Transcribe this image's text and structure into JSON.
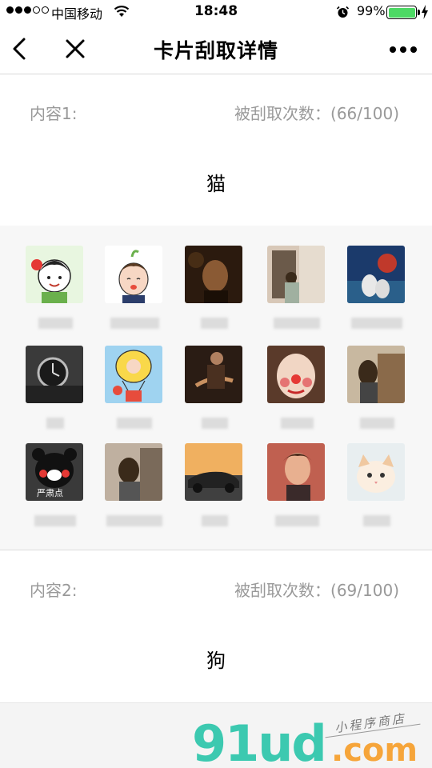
{
  "status_bar": {
    "carrier": "中国移动",
    "time": "18:48",
    "battery_pct": "99%",
    "icons": [
      "signal-dots-icon",
      "wifi-icon",
      "alarm-icon",
      "battery-icon",
      "charging-bolt-icon"
    ]
  },
  "nav": {
    "title": "卡片刮取详情",
    "icons": [
      "back-chevron-icon",
      "close-icon",
      "more-dots-icon"
    ]
  },
  "contents": [
    {
      "label": "内容1:",
      "count": "被刮取次数：(66/100)",
      "word": "猫"
    },
    {
      "label": "内容2:",
      "count": "被刮取次数：(69/100)",
      "word": "狗"
    }
  ],
  "scrapers": [
    {
      "avatar": "cartoon-girl-sticker",
      "name_width": 0.58
    },
    {
      "avatar": "cartoon-boy-sticker",
      "name_width": 0.82
    },
    {
      "avatar": "dark-portrait",
      "name_width": 0.46
    },
    {
      "avatar": "person-by-door",
      "name_width": 0.78
    },
    {
      "avatar": "couple-by-sea",
      "name_width": 0.86
    },
    {
      "avatar": "wristwatch",
      "name_width": 0.3
    },
    {
      "avatar": "cartoon-balloon",
      "name_width": 0.6
    },
    {
      "avatar": "guitar-player",
      "name_width": 0.45
    },
    {
      "avatar": "clown-face",
      "name_width": 0.56
    },
    {
      "avatar": "girl-by-fence",
      "name_width": 0.58
    },
    {
      "avatar": "black-bear-mascot",
      "name_width": 0.7
    },
    {
      "avatar": "girl-by-wall",
      "name_width": 0.94
    },
    {
      "avatar": "sports-car",
      "name_width": 0.44
    },
    {
      "avatar": "man-singing",
      "name_width": 0.74
    },
    {
      "avatar": "white-kitten",
      "name_width": 0.46
    }
  ],
  "watermark": {
    "logo": "91ud",
    "suffix": ".com",
    "tagline": "小程序商店"
  }
}
